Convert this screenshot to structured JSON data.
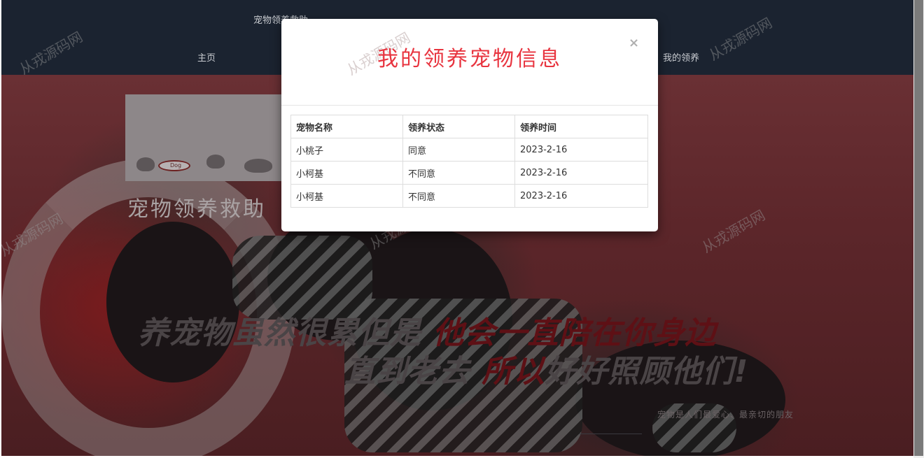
{
  "navbar": {
    "brand": "宠物领养救助",
    "links": [
      {
        "label": "主页"
      },
      {
        "label": "我的领养"
      }
    ]
  },
  "hero": {
    "site_title": "宠物领养救助",
    "logo_bowl_text": "Dog",
    "slogan_line1_plain": "养宠物虽然很累但是",
    "slogan_line1_red": "他会一直陪在你身边",
    "slogan_line2_plain1": "直到老去",
    "slogan_line2_red": "所以",
    "slogan_line2_plain2": "好好照顾他们!",
    "sub_slogan": "宠物是人们最爱心、最亲切的朋友"
  },
  "watermark": "从戎源码网",
  "modal": {
    "title": "我的领养宠物信息",
    "close_symbol": "×",
    "table": {
      "headers": [
        "宠物名称",
        "领养状态",
        "领养时间"
      ],
      "rows": [
        [
          "小桃子",
          "同意",
          "2023-2-16"
        ],
        [
          "小柯基",
          "不同意",
          "2023-2-16"
        ],
        [
          "小柯基",
          "不同意",
          "2023-2-16"
        ]
      ]
    }
  },
  "colors": {
    "navbar_bg": "#1b2330",
    "modal_title": "#e8343f",
    "hero_bg": "#5c262a"
  }
}
